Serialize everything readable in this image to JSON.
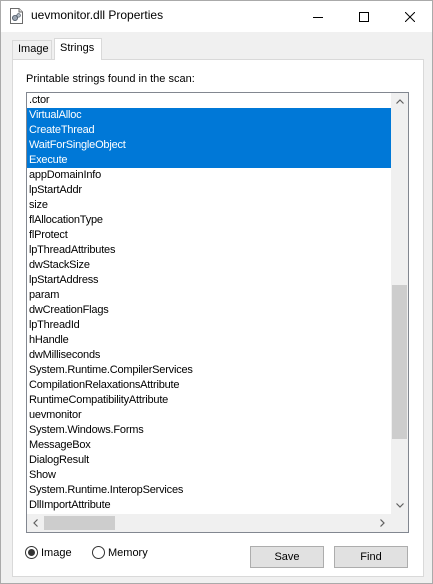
{
  "window": {
    "title": "uevmonitor.dll Properties",
    "icon": "dll-file-icon"
  },
  "title_buttons": {
    "minimize": "minimize-icon",
    "maximize": "maximize-icon",
    "close": "close-icon"
  },
  "tabs": [
    {
      "label": "Image",
      "active": false
    },
    {
      "label": "Strings",
      "active": true
    }
  ],
  "panel": {
    "label": "Printable strings found in the scan:"
  },
  "strings_list": {
    "items": [
      {
        "text": ".ctor",
        "selected": false
      },
      {
        "text": "VirtualAlloc",
        "selected": true
      },
      {
        "text": "CreateThread",
        "selected": true
      },
      {
        "text": "WaitForSingleObject",
        "selected": true
      },
      {
        "text": "Execute",
        "selected": true
      },
      {
        "text": "appDomainInfo",
        "selected": false
      },
      {
        "text": "lpStartAddr",
        "selected": false
      },
      {
        "text": "size",
        "selected": false
      },
      {
        "text": "flAllocationType",
        "selected": false
      },
      {
        "text": "flProtect",
        "selected": false
      },
      {
        "text": "lpThreadAttributes",
        "selected": false
      },
      {
        "text": "dwStackSize",
        "selected": false
      },
      {
        "text": "lpStartAddress",
        "selected": false
      },
      {
        "text": "param",
        "selected": false
      },
      {
        "text": "dwCreationFlags",
        "selected": false
      },
      {
        "text": "lpThreadId",
        "selected": false
      },
      {
        "text": "hHandle",
        "selected": false
      },
      {
        "text": "dwMilliseconds",
        "selected": false
      },
      {
        "text": "System.Runtime.CompilerServices",
        "selected": false
      },
      {
        "text": "CompilationRelaxationsAttribute",
        "selected": false
      },
      {
        "text": "RuntimeCompatibilityAttribute",
        "selected": false
      },
      {
        "text": "uevmonitor",
        "selected": false
      },
      {
        "text": "System.Windows.Forms",
        "selected": false
      },
      {
        "text": "MessageBox",
        "selected": false
      },
      {
        "text": "DialogResult",
        "selected": false
      },
      {
        "text": "Show",
        "selected": false
      },
      {
        "text": "System.Runtime.InteropServices",
        "selected": false
      },
      {
        "text": "DllImportAttribute",
        "selected": false
      }
    ],
    "selection_color": "#0078d7"
  },
  "mode": {
    "options": [
      {
        "label": "Image",
        "checked": true
      },
      {
        "label": "Memory",
        "checked": false
      }
    ]
  },
  "buttons": {
    "save_label": "Save",
    "find_label": "Find"
  }
}
